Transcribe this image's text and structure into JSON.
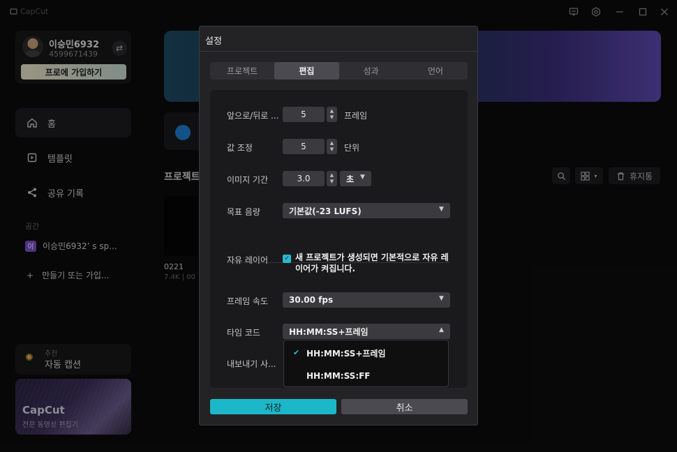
{
  "app": {
    "name": "CapCut"
  },
  "sidebar": {
    "profile": {
      "name": "이승민6932",
      "id": "4599671439",
      "pro_button": "프로에 가입하기"
    },
    "nav": [
      {
        "label": "홈",
        "icon": "home-icon"
      },
      {
        "label": "템플릿",
        "icon": "template-icon"
      },
      {
        "label": "공유 기록",
        "icon": "share-icon"
      }
    ],
    "section_label": "공간",
    "space": {
      "badge": "이",
      "label": "이승민6932’ s sp..."
    },
    "create_label": "만들기 또는 가입...",
    "caption_card": {
      "small": "추천",
      "title": "자동 캡션"
    },
    "promo": {
      "title": "CapCut",
      "subtitle": "전문 동영상 편집기"
    }
  },
  "main": {
    "projects_title": "프로젝트",
    "trash_label": "휴지통",
    "project": {
      "name": "0221",
      "meta": "7.4K | 00"
    }
  },
  "dialog": {
    "title": "설정",
    "tabs": [
      "프로젝트",
      "편집",
      "성과",
      "언어"
    ],
    "active_tab": "편집",
    "rows": {
      "frame_step": {
        "label": "앞으로/뒤로 ...",
        "value": "5",
        "unit": "프레임"
      },
      "value_step": {
        "label": "값 조정",
        "value": "5",
        "unit": "단위"
      },
      "image_duration": {
        "label": "이미지 기간",
        "value": "3.0",
        "unit": "초"
      },
      "target_loudness": {
        "label": "목표 음량",
        "value": "기본값(-23 LUFS)"
      },
      "free_layer": {
        "label": "자유 레이어",
        "checked": true,
        "text": "새 프로젝트가 생성되면 기본적으로 자유 레이어가 켜집니다."
      },
      "frame_rate": {
        "label": "프레임 속도",
        "value": "30.00 fps"
      },
      "timecode": {
        "label": "타임 코드",
        "value": "HH:MM:SS+프레임"
      },
      "export": {
        "label": "내보내기 사..."
      }
    },
    "timecode_options": [
      "HH:MM:SS+프레임",
      "HH:MM:SS:FF"
    ],
    "save_label": "저장",
    "cancel_label": "취소"
  },
  "colors": {
    "accent": "#1cb7c8",
    "dialog_bg": "#232326",
    "panel_bg": "#1a1a1c"
  }
}
